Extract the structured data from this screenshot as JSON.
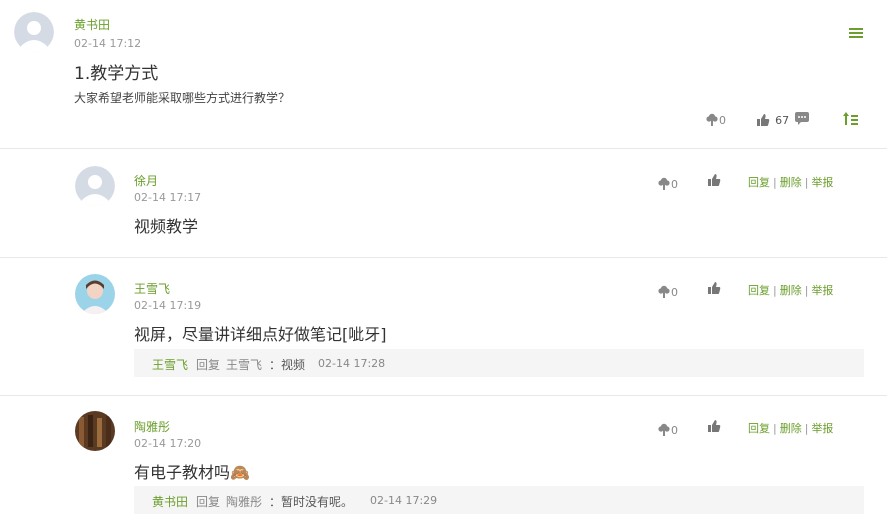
{
  "post": {
    "author": "黄书田",
    "time": "02-14 17:12",
    "title": "1.教学方式",
    "body": "大家希望老师能采取哪些方式进行教学？",
    "flower_count": "0",
    "like_count": "67"
  },
  "comments": [
    {
      "author": "徐月",
      "time": "02-14 17:17",
      "content": "视频教学",
      "flower_count": "0",
      "reply_label": "回复",
      "delete_label": "删除",
      "report_label": "举报"
    },
    {
      "author": "王雪飞",
      "time": "02-14 17:19",
      "content": "视屏，尽量讲详细点好做笔记[呲牙]",
      "flower_count": "0",
      "reply_label": "回复",
      "delete_label": "删除",
      "report_label": "举报",
      "reply": {
        "from": "王雪飞",
        "verb": "回复",
        "to": "王雪飞",
        "text": "：视频",
        "time": "02-14 17:28"
      }
    },
    {
      "author": "陶雅彤",
      "time": "02-14 17:20",
      "content": "有电子教材吗🙈",
      "flower_count": "0",
      "reply_label": "回复",
      "delete_label": "删除",
      "report_label": "举报",
      "reply": {
        "from": "黄书田",
        "verb": "回复",
        "to": "陶雅彤",
        "text": "：暂时没有呢。",
        "time": "02-14 17:29"
      }
    }
  ],
  "separator": "|",
  "colors": {
    "accent": "#6b9e2c",
    "muted": "#999999",
    "divider": "#e8e8e8"
  }
}
